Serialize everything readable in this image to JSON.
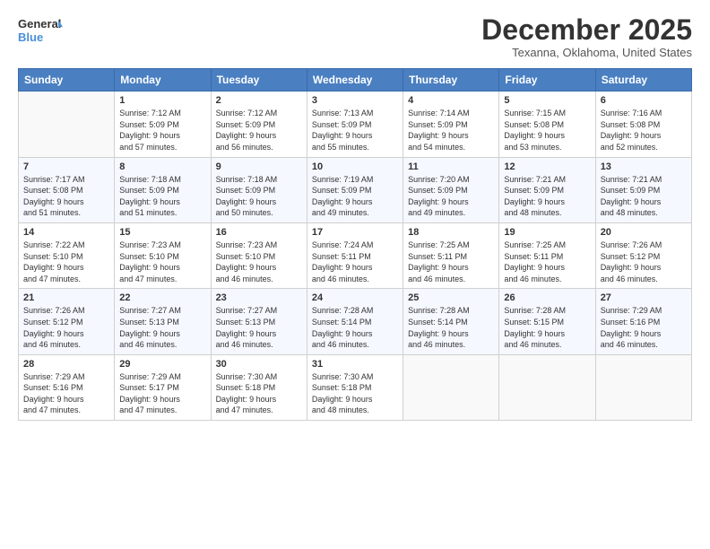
{
  "header": {
    "logo_line1": "General",
    "logo_line2": "Blue",
    "month": "December 2025",
    "location": "Texanna, Oklahoma, United States"
  },
  "days_of_week": [
    "Sunday",
    "Monday",
    "Tuesday",
    "Wednesday",
    "Thursday",
    "Friday",
    "Saturday"
  ],
  "weeks": [
    [
      {
        "day": "",
        "info": ""
      },
      {
        "day": "1",
        "info": "Sunrise: 7:12 AM\nSunset: 5:09 PM\nDaylight: 9 hours\nand 57 minutes."
      },
      {
        "day": "2",
        "info": "Sunrise: 7:12 AM\nSunset: 5:09 PM\nDaylight: 9 hours\nand 56 minutes."
      },
      {
        "day": "3",
        "info": "Sunrise: 7:13 AM\nSunset: 5:09 PM\nDaylight: 9 hours\nand 55 minutes."
      },
      {
        "day": "4",
        "info": "Sunrise: 7:14 AM\nSunset: 5:09 PM\nDaylight: 9 hours\nand 54 minutes."
      },
      {
        "day": "5",
        "info": "Sunrise: 7:15 AM\nSunset: 5:08 PM\nDaylight: 9 hours\nand 53 minutes."
      },
      {
        "day": "6",
        "info": "Sunrise: 7:16 AM\nSunset: 5:08 PM\nDaylight: 9 hours\nand 52 minutes."
      }
    ],
    [
      {
        "day": "7",
        "info": "Sunrise: 7:17 AM\nSunset: 5:08 PM\nDaylight: 9 hours\nand 51 minutes."
      },
      {
        "day": "8",
        "info": "Sunrise: 7:18 AM\nSunset: 5:09 PM\nDaylight: 9 hours\nand 51 minutes."
      },
      {
        "day": "9",
        "info": "Sunrise: 7:18 AM\nSunset: 5:09 PM\nDaylight: 9 hours\nand 50 minutes."
      },
      {
        "day": "10",
        "info": "Sunrise: 7:19 AM\nSunset: 5:09 PM\nDaylight: 9 hours\nand 49 minutes."
      },
      {
        "day": "11",
        "info": "Sunrise: 7:20 AM\nSunset: 5:09 PM\nDaylight: 9 hours\nand 49 minutes."
      },
      {
        "day": "12",
        "info": "Sunrise: 7:21 AM\nSunset: 5:09 PM\nDaylight: 9 hours\nand 48 minutes."
      },
      {
        "day": "13",
        "info": "Sunrise: 7:21 AM\nSunset: 5:09 PM\nDaylight: 9 hours\nand 48 minutes."
      }
    ],
    [
      {
        "day": "14",
        "info": "Sunrise: 7:22 AM\nSunset: 5:10 PM\nDaylight: 9 hours\nand 47 minutes."
      },
      {
        "day": "15",
        "info": "Sunrise: 7:23 AM\nSunset: 5:10 PM\nDaylight: 9 hours\nand 47 minutes."
      },
      {
        "day": "16",
        "info": "Sunrise: 7:23 AM\nSunset: 5:10 PM\nDaylight: 9 hours\nand 46 minutes."
      },
      {
        "day": "17",
        "info": "Sunrise: 7:24 AM\nSunset: 5:11 PM\nDaylight: 9 hours\nand 46 minutes."
      },
      {
        "day": "18",
        "info": "Sunrise: 7:25 AM\nSunset: 5:11 PM\nDaylight: 9 hours\nand 46 minutes."
      },
      {
        "day": "19",
        "info": "Sunrise: 7:25 AM\nSunset: 5:11 PM\nDaylight: 9 hours\nand 46 minutes."
      },
      {
        "day": "20",
        "info": "Sunrise: 7:26 AM\nSunset: 5:12 PM\nDaylight: 9 hours\nand 46 minutes."
      }
    ],
    [
      {
        "day": "21",
        "info": "Sunrise: 7:26 AM\nSunset: 5:12 PM\nDaylight: 9 hours\nand 46 minutes."
      },
      {
        "day": "22",
        "info": "Sunrise: 7:27 AM\nSunset: 5:13 PM\nDaylight: 9 hours\nand 46 minutes."
      },
      {
        "day": "23",
        "info": "Sunrise: 7:27 AM\nSunset: 5:13 PM\nDaylight: 9 hours\nand 46 minutes."
      },
      {
        "day": "24",
        "info": "Sunrise: 7:28 AM\nSunset: 5:14 PM\nDaylight: 9 hours\nand 46 minutes."
      },
      {
        "day": "25",
        "info": "Sunrise: 7:28 AM\nSunset: 5:14 PM\nDaylight: 9 hours\nand 46 minutes."
      },
      {
        "day": "26",
        "info": "Sunrise: 7:28 AM\nSunset: 5:15 PM\nDaylight: 9 hours\nand 46 minutes."
      },
      {
        "day": "27",
        "info": "Sunrise: 7:29 AM\nSunset: 5:16 PM\nDaylight: 9 hours\nand 46 minutes."
      }
    ],
    [
      {
        "day": "28",
        "info": "Sunrise: 7:29 AM\nSunset: 5:16 PM\nDaylight: 9 hours\nand 47 minutes."
      },
      {
        "day": "29",
        "info": "Sunrise: 7:29 AM\nSunset: 5:17 PM\nDaylight: 9 hours\nand 47 minutes."
      },
      {
        "day": "30",
        "info": "Sunrise: 7:30 AM\nSunset: 5:18 PM\nDaylight: 9 hours\nand 47 minutes."
      },
      {
        "day": "31",
        "info": "Sunrise: 7:30 AM\nSunset: 5:18 PM\nDaylight: 9 hours\nand 48 minutes."
      },
      {
        "day": "",
        "info": ""
      },
      {
        "day": "",
        "info": ""
      },
      {
        "day": "",
        "info": ""
      }
    ]
  ]
}
